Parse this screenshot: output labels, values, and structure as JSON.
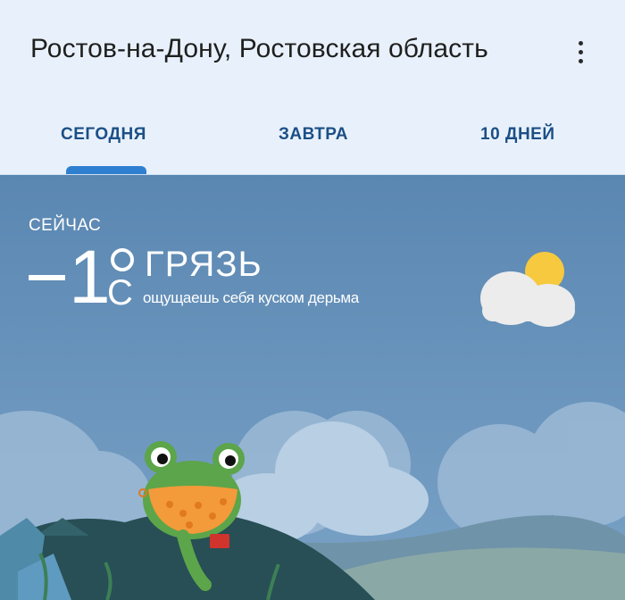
{
  "header": {
    "location": "Ростов-на-Дону, Ростовская область",
    "more_icon": "more-vert-icon"
  },
  "tabs": [
    {
      "label": "СЕГОДНЯ",
      "selected": true
    },
    {
      "label": "ЗАВТРА",
      "selected": false
    },
    {
      "label": "10 ДНЕЙ",
      "selected": false
    }
  ],
  "current": {
    "label": "СЕЙЧАС",
    "temperature": "−1",
    "unit": "C",
    "condition": "ГРЯЗЬ",
    "feels_like": "ощущаешь себя куском дерьма",
    "icon": "partly-cloudy-icon"
  },
  "colors": {
    "header_bg": "#e8f1fb",
    "accent": "#2f7fd1",
    "tab_text": "#1c4f86",
    "sky": "#5d8bb5"
  }
}
